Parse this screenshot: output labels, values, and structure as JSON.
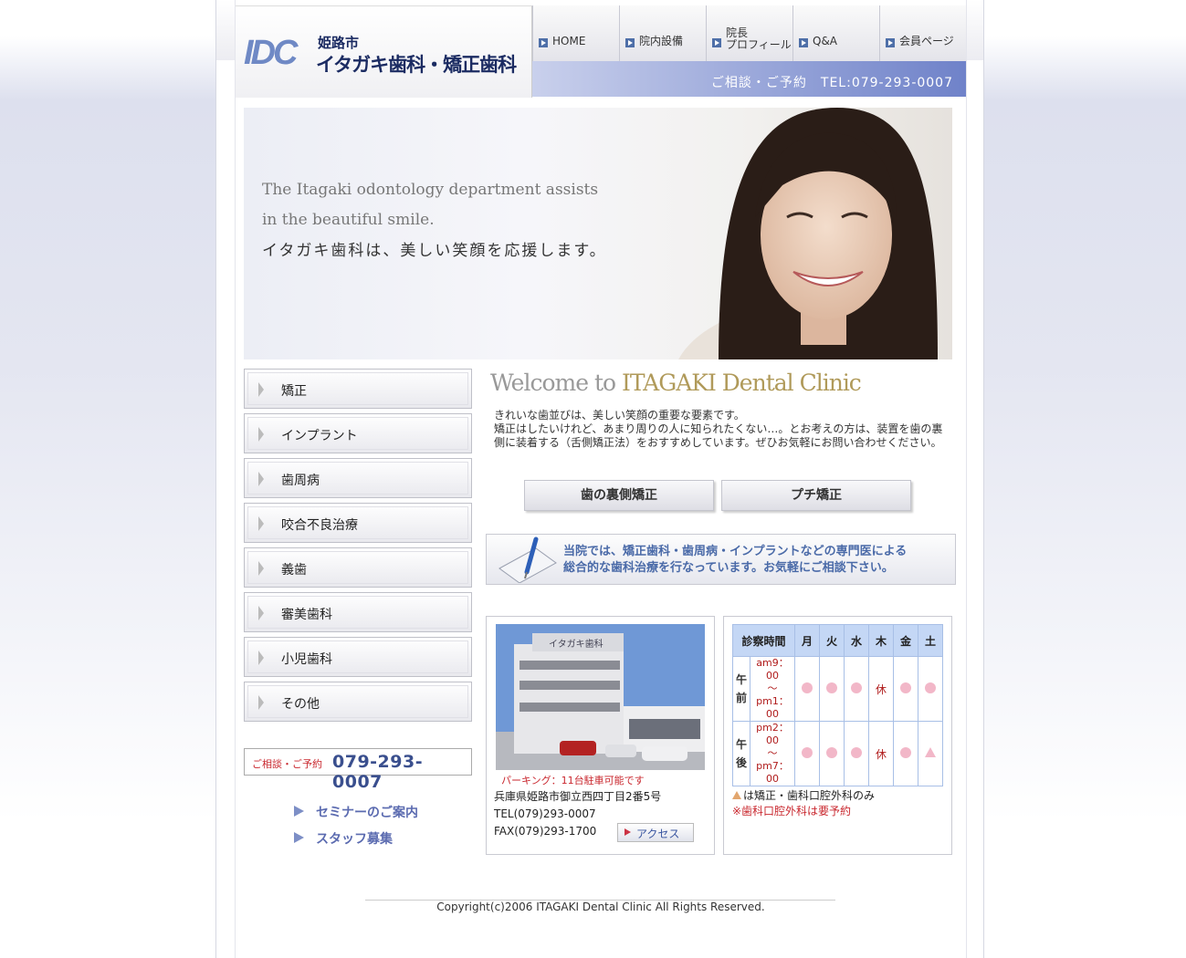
{
  "header": {
    "logo_mark": "IDC",
    "city": "姫路市",
    "clinic_name": "イタガキ歯科・矯正歯科",
    "tel_bar": "ご相談・ご予約　TEL:079-293-0007"
  },
  "nav": [
    {
      "label": "HOME"
    },
    {
      "label": "院内設備"
    },
    {
      "label": "院長\nプロフィール"
    },
    {
      "label": "Q&A"
    },
    {
      "label": "会員ページ"
    }
  ],
  "hero": {
    "en_line1": "The Itagaki odontology department assists",
    "en_line2": "in the beautiful smile.",
    "jp": "イタガキ歯科は、美しい笑顔を応援します。"
  },
  "side_menu": [
    {
      "label": "矯正"
    },
    {
      "label": "インプラント"
    },
    {
      "label": "歯周病"
    },
    {
      "label": "咬合不良治療"
    },
    {
      "label": "義歯"
    },
    {
      "label": "審美歯科"
    },
    {
      "label": "小児歯科"
    },
    {
      "label": "その他"
    }
  ],
  "side_tel": {
    "label": "ご相談・ご予約",
    "number": "079-293-0007"
  },
  "side_links": [
    {
      "label": "セミナーのご案内"
    },
    {
      "label": "スタッフ募集"
    }
  ],
  "welcome": {
    "prefix": "Welcome to ",
    "brand": "ITAGAKI Dental Clinic"
  },
  "intro": "きれいな歯並びは、美しい笑顔の重要な要素です。\n矯正はしたいけれど、あまり周りの人に知られたくない…。とお考えの方は、装置を歯の裏側に装着する（舌側矯正法）をおすすめしています。ぜひお気軽にお問い合わせください。",
  "buttons": {
    "lingual": "歯の裏側矯正",
    "petit": "プチ矯正"
  },
  "banner": {
    "line1": "当院では、矯正歯科・歯周病・インプラントなどの専門医による",
    "line2": "総合的な歯科治療を行なっています。お気軽にご相談下さい。"
  },
  "clinic": {
    "parking": "パーキング：11台駐車可能です",
    "address": "兵庫県姫路市御立西四丁目2番5号",
    "tel": "TEL(079)293-0007",
    "fax": "FAX(079)293-1700",
    "access": "アクセス",
    "sign_text": "イタガキ歯科"
  },
  "hours": {
    "header": "診察時間",
    "days": [
      "月",
      "火",
      "水",
      "木",
      "金",
      "土"
    ],
    "rows": [
      {
        "period": "午前",
        "time_start": "am9：00",
        "tilde": "〜",
        "time_end": "pm1：00",
        "cells": [
          "dot",
          "dot",
          "dot",
          "休",
          "dot",
          "dot"
        ]
      },
      {
        "period": "午後",
        "time_start": "pm2：00",
        "tilde": "〜",
        "time_end": "pm7：00",
        "cells": [
          "dot",
          "dot",
          "dot",
          "休",
          "dot",
          "triangle"
        ]
      }
    ],
    "note1": "は矯正・歯科口腔外科のみ",
    "note2": "※歯科口腔外科は要予約"
  },
  "footer": {
    "copyright": "Copyright(c)2006 ITAGAKI Dental Clinic All Rights Reserved."
  },
  "colors": {
    "accent": "#6f82c9",
    "nav_icon": "#4e6fa8",
    "red": "#c9272e",
    "dot": "#f2b7c8"
  }
}
